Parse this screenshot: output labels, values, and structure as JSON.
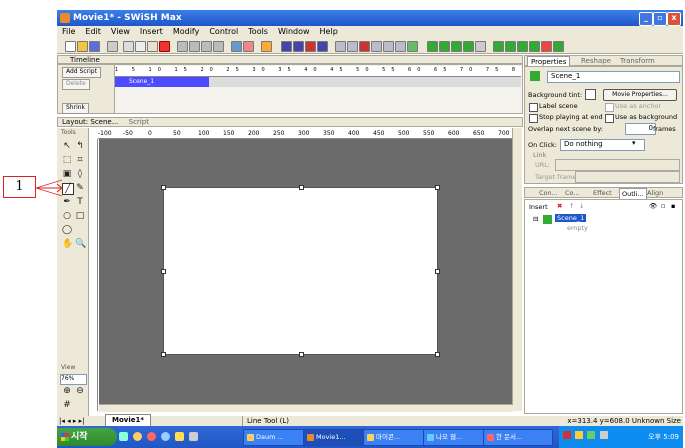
{
  "window": {
    "title": "Movie1* - SWiSH Max"
  },
  "menu": [
    "File",
    "Edit",
    "View",
    "Insert",
    "Modify",
    "Control",
    "Tools",
    "Window",
    "Help"
  ],
  "timeline": {
    "panel_title": "Timeline",
    "add_script": "Add Script",
    "delete": "Delete",
    "shrink": "Shrink",
    "scene_label": "Scene_1",
    "frame_numbers": "1  5  10  15  20  25  30  35  40  45  50  55  60  65  70  75  80  85  90"
  },
  "layout": {
    "tab_layout": "Layout: Scene...",
    "tab_script": "Script",
    "tools_label": "Tools",
    "view_label": "View",
    "zoom": "76%",
    "ruler": [
      "-100",
      "-50",
      "0",
      "50",
      "100",
      "150",
      "200",
      "250",
      "300",
      "350",
      "400",
      "450",
      "500",
      "550",
      "600",
      "650",
      "700"
    ]
  },
  "properties": {
    "tabs": [
      "Properties",
      "Reshape",
      "Transform"
    ],
    "scene_name": "Scene_1",
    "background_tint_label": "Background tint:",
    "movie_properties": "Movie Properties...",
    "label_scene": "Label scene",
    "use_as_anchor": "Use as anchor",
    "stop_playing_at_end": "Stop playing at end",
    "use_as_background": "Use as background",
    "overlap_next_scene_by": "Overlap next scene by:",
    "overlap_value": "0",
    "frames_label": "frames",
    "on_click_label": "On Click:",
    "on_click_value": "Do nothing",
    "link_label": "Link",
    "url_label": "URL:",
    "target_frame_label": "Target frame:"
  },
  "outline": {
    "tabs": [
      "Con...",
      "Co...",
      "Effect",
      "Outli...",
      "Align"
    ],
    "insert_label": "Insert",
    "scene": "Scene_1",
    "child": "empty"
  },
  "bottom": {
    "movie_tab": "Movie1*",
    "status_tool": "Line Tool (L)",
    "status_coords": "x=313.4 y=608.0 Unknown Size"
  },
  "taskbar": {
    "start": "시작",
    "tasks": [
      "Daum ...",
      "Movie1...",
      "마이콘...",
      "나모 웹...",
      "한 문서..."
    ],
    "clock": "오후 5:09"
  },
  "annotation": {
    "callout_number": "1"
  }
}
